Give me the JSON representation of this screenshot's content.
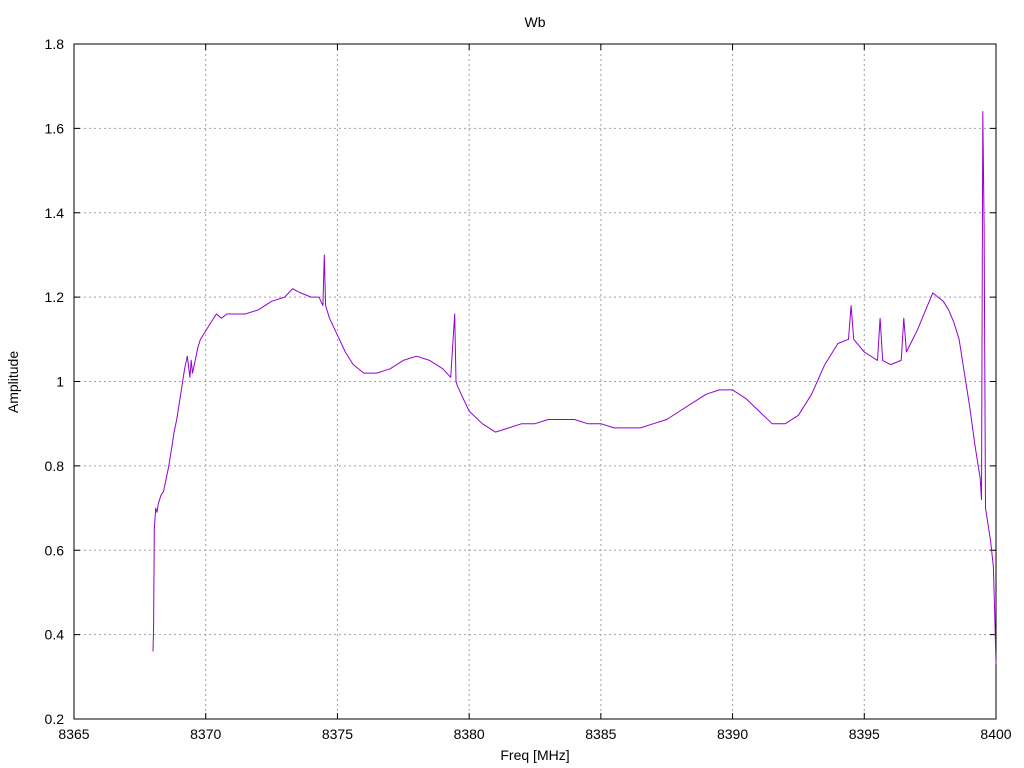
{
  "chart_data": {
    "type": "line",
    "title": "Wb",
    "xlabel": "Freq [MHz]",
    "ylabel": "Amplitude",
    "xlim": [
      8365,
      8400
    ],
    "ylim": [
      0.2,
      1.8
    ],
    "xticks": [
      8365,
      8370,
      8375,
      8380,
      8385,
      8390,
      8395,
      8400
    ],
    "xtick_labels": [
      "8365",
      "8370",
      "8375",
      "8380",
      "8385",
      "8390",
      "8395",
      "8400"
    ],
    "yticks": [
      0.2,
      0.4,
      0.6,
      0.8,
      1.0,
      1.2,
      1.4,
      1.6,
      1.8
    ],
    "ytick_labels": [
      "0.2",
      "0.4",
      "0.6",
      "0.8",
      "1",
      "1.2",
      "1.4",
      "1.6",
      "1.8"
    ],
    "grid": true,
    "series_color": "#9400d3",
    "series": [
      {
        "x": [
          8368.0,
          8368.02,
          8368.05,
          8368.1,
          8368.15,
          8368.2,
          8368.3,
          8368.4,
          8368.5,
          8368.6,
          8368.7,
          8368.8,
          8368.9,
          8369.0,
          8369.1,
          8369.2,
          8369.3,
          8369.4,
          8369.45,
          8369.5,
          8369.6,
          8369.7,
          8369.8,
          8369.9,
          8370.0,
          8370.2,
          8370.4,
          8370.6,
          8370.8,
          8371.0,
          8371.5,
          8372.0,
          8372.5,
          8373.0,
          8373.3,
          8373.6,
          8374.0,
          8374.3,
          8374.45,
          8374.5,
          8374.55,
          8374.7,
          8375.0,
          8375.3,
          8375.6,
          8376.0,
          8376.5,
          8377.0,
          8377.5,
          8378.0,
          8378.5,
          8379.0,
          8379.3,
          8379.45,
          8379.5,
          8379.55,
          8379.7,
          8380.0,
          8380.5,
          8381.0,
          8381.5,
          8382.0,
          8382.5,
          8383.0,
          8383.5,
          8384.0,
          8384.5,
          8385.0,
          8385.5,
          8386.0,
          8386.5,
          8387.0,
          8387.5,
          8388.0,
          8388.5,
          8389.0,
          8389.5,
          8390.0,
          8390.5,
          8391.0,
          8391.5,
          8392.0,
          8392.5,
          8393.0,
          8393.5,
          8394.0,
          8394.4,
          8394.5,
          8394.6,
          8395.0,
          8395.5,
          8395.6,
          8395.7,
          8396.0,
          8396.4,
          8396.5,
          8396.6,
          8397.0,
          8397.4,
          8397.6,
          8397.8,
          8398.0,
          8398.2,
          8398.4,
          8398.6,
          8398.8,
          8399.0,
          8399.2,
          8399.4,
          8399.45,
          8399.5,
          8399.55,
          8399.6,
          8399.7,
          8399.8,
          8399.9,
          8399.95,
          8400.0
        ],
        "y": [
          0.36,
          0.42,
          0.65,
          0.7,
          0.69,
          0.71,
          0.73,
          0.74,
          0.77,
          0.8,
          0.84,
          0.88,
          0.91,
          0.95,
          0.99,
          1.03,
          1.06,
          1.01,
          1.05,
          1.02,
          1.05,
          1.08,
          1.1,
          1.11,
          1.12,
          1.14,
          1.16,
          1.15,
          1.16,
          1.16,
          1.16,
          1.17,
          1.19,
          1.2,
          1.22,
          1.21,
          1.2,
          1.2,
          1.18,
          1.3,
          1.18,
          1.15,
          1.11,
          1.07,
          1.04,
          1.02,
          1.02,
          1.03,
          1.05,
          1.06,
          1.05,
          1.03,
          1.01,
          1.16,
          1.0,
          0.99,
          0.97,
          0.93,
          0.9,
          0.88,
          0.89,
          0.9,
          0.9,
          0.91,
          0.91,
          0.91,
          0.9,
          0.9,
          0.89,
          0.89,
          0.89,
          0.9,
          0.91,
          0.93,
          0.95,
          0.97,
          0.98,
          0.98,
          0.96,
          0.93,
          0.9,
          0.9,
          0.92,
          0.97,
          1.04,
          1.09,
          1.1,
          1.18,
          1.1,
          1.07,
          1.05,
          1.15,
          1.05,
          1.04,
          1.05,
          1.15,
          1.07,
          1.12,
          1.18,
          1.21,
          1.2,
          1.19,
          1.17,
          1.14,
          1.1,
          1.02,
          0.94,
          0.85,
          0.77,
          0.72,
          1.64,
          1.37,
          0.7,
          0.66,
          0.62,
          0.56,
          0.45,
          0.33
        ]
      }
    ]
  }
}
